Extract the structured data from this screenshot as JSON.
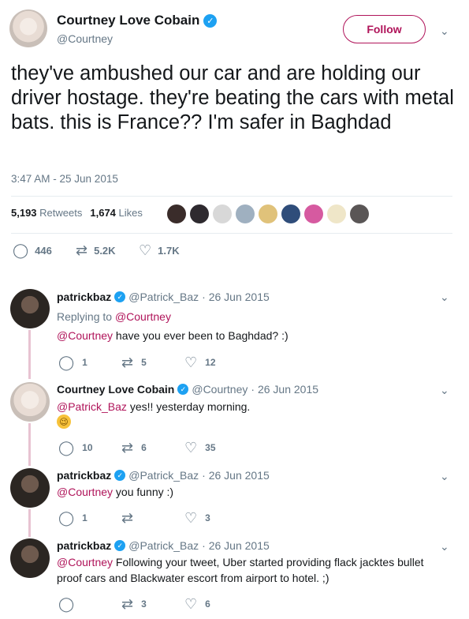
{
  "main_tweet": {
    "name": "Courtney Love Cobain",
    "handle": "@Courtney",
    "follow_label": "Follow",
    "text": "they've ambushed our car and are holding our driver hostage. they're beating the cars with metal bats. this is France?? I'm safer in Baghdad",
    "timestamp": "3:47 AM - 25 Jun 2015",
    "retweets_count": "5,193",
    "retweets_label": "Retweets",
    "likes_count": "1,674",
    "likes_label": "Likes",
    "replies": "446",
    "retweets_short": "5.2K",
    "likes_short": "1.7K",
    "liker_colors": [
      "#3a2c2a",
      "#2e2a2f",
      "#d8d8d8",
      "#9fb0c0",
      "#e0c27a",
      "#2f4d7a",
      "#d65aa0",
      "#efe6c8",
      "#5a5656"
    ]
  },
  "replies": [
    {
      "name": "patrickbaz",
      "handle": "@Patrick_Baz",
      "date": "· 26 Jun 2015",
      "replying_to_label": "Replying to",
      "replying_to": "@Courtney",
      "mention": "@Courtney",
      "text": "have you ever been to Baghdad? :)",
      "reply_count": "1",
      "retweet_count": "5",
      "like_count": "12"
    },
    {
      "name": "Courtney Love Cobain",
      "handle": "@Courtney",
      "date": "· 26 Jun 2015",
      "mention": "@Patrick_Baz",
      "text": "yes!!  yesterday morning.",
      "emoji": "😉",
      "reply_count": "10",
      "retweet_count": "6",
      "like_count": "35"
    },
    {
      "name": "patrickbaz",
      "handle": "@Patrick_Baz",
      "date": "· 26 Jun 2015",
      "mention": "@Courtney",
      "text": "you funny :)",
      "reply_count": "1",
      "retweet_count": "",
      "like_count": "3"
    },
    {
      "name": "patrickbaz",
      "handle": "@Patrick_Baz",
      "date": "· 26 Jun 2015",
      "mention": "@Courtney",
      "text_line1": "Following your tweet, Uber started providing flack jacktes bullet",
      "text_line2": "proof cars and Blackwater escort from airport to hotel. ;)",
      "reply_count": "",
      "retweet_count": "3",
      "like_count": "6"
    }
  ],
  "icons": {
    "reply": "reply-icon",
    "retweet": "retweet-icon",
    "like": "heart-icon",
    "more": "chevron-down-icon",
    "verified": "verified-badge-icon"
  },
  "colors": {
    "accent": "#b0145a",
    "verified": "#1da1f2",
    "muted": "#657786",
    "thread_line": "#e8c3d2"
  }
}
